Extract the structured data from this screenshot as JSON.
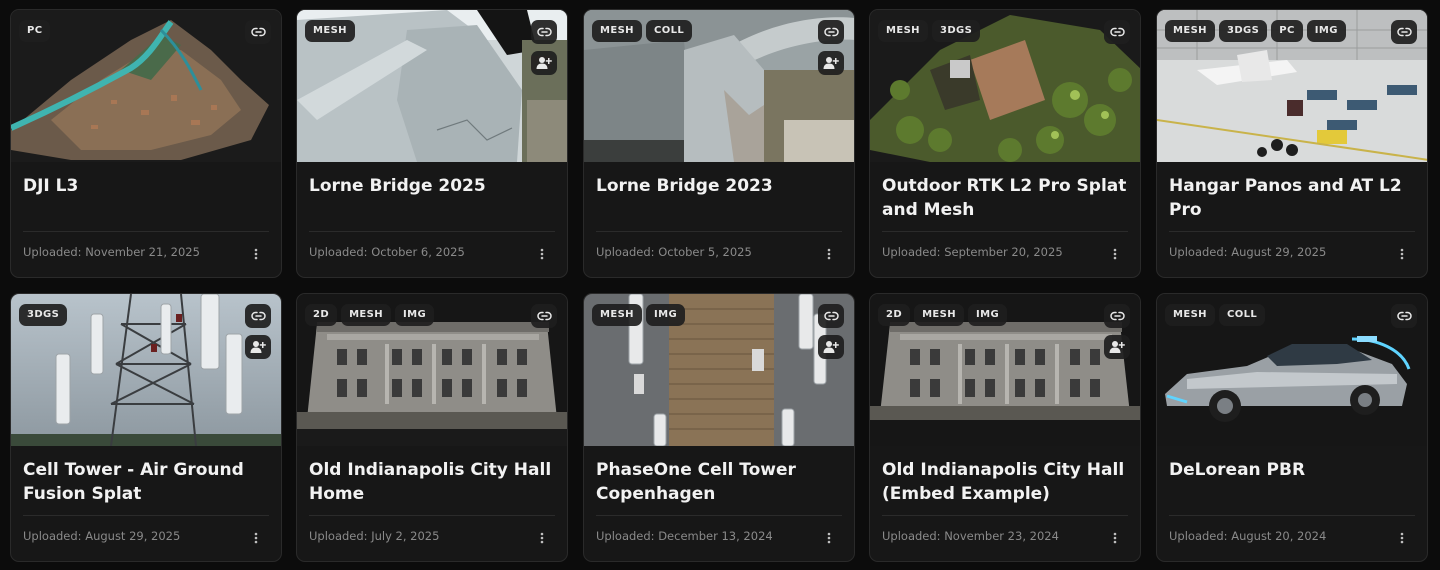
{
  "projects": [
    {
      "title": "DJI L3",
      "uploaded": "Uploaded: November 21, 2025",
      "tags": [
        "PC"
      ],
      "has_share": false
    },
    {
      "title": "Lorne Bridge 2025",
      "uploaded": "Uploaded: October 6, 2025",
      "tags": [
        "MESH"
      ],
      "has_share": true
    },
    {
      "title": "Lorne Bridge 2023",
      "uploaded": "Uploaded: October 5, 2025",
      "tags": [
        "MESH",
        "COLL"
      ],
      "has_share": true
    },
    {
      "title": "Outdoor RTK L2 Pro Splat and Mesh",
      "uploaded": "Uploaded: September 20, 2025",
      "tags": [
        "MESH",
        "3DGS"
      ],
      "has_share": false
    },
    {
      "title": "Hangar Panos and AT L2 Pro",
      "uploaded": "Uploaded: August 29, 2025",
      "tags": [
        "MESH",
        "3DGS",
        "PC",
        "IMG"
      ],
      "has_share": false
    },
    {
      "title": "Cell Tower - Air Ground Fusion Splat",
      "uploaded": "Uploaded: August 29, 2025",
      "tags": [
        "3DGS"
      ],
      "has_share": true
    },
    {
      "title": "Old Indianapolis City Hall Home",
      "uploaded": "Uploaded: July 2, 2025",
      "tags": [
        "2D",
        "MESH",
        "IMG"
      ],
      "has_share": false
    },
    {
      "title": "PhaseOne Cell Tower Copenhagen",
      "uploaded": "Uploaded: December 13, 2024",
      "tags": [
        "MESH",
        "IMG"
      ],
      "has_share": true
    },
    {
      "title": "Old Indianapolis City Hall (Embed Example)",
      "uploaded": "Uploaded: November 23, 2024",
      "tags": [
        "2D",
        "MESH",
        "IMG"
      ],
      "has_share": true
    },
    {
      "title": "DeLorean PBR",
      "uploaded": "Uploaded: August 20, 2024",
      "tags": [
        "MESH",
        "COLL"
      ],
      "has_share": false
    }
  ],
  "icons": {
    "link": "link-icon",
    "share": "share-user-icon",
    "more": "more-vertical-icon"
  },
  "colors": {
    "background": "#0c0c0c",
    "card": "#171717",
    "tag_bg": "#1e1e1e",
    "title": "#f2f2f2",
    "meta": "#8a8a8a"
  }
}
